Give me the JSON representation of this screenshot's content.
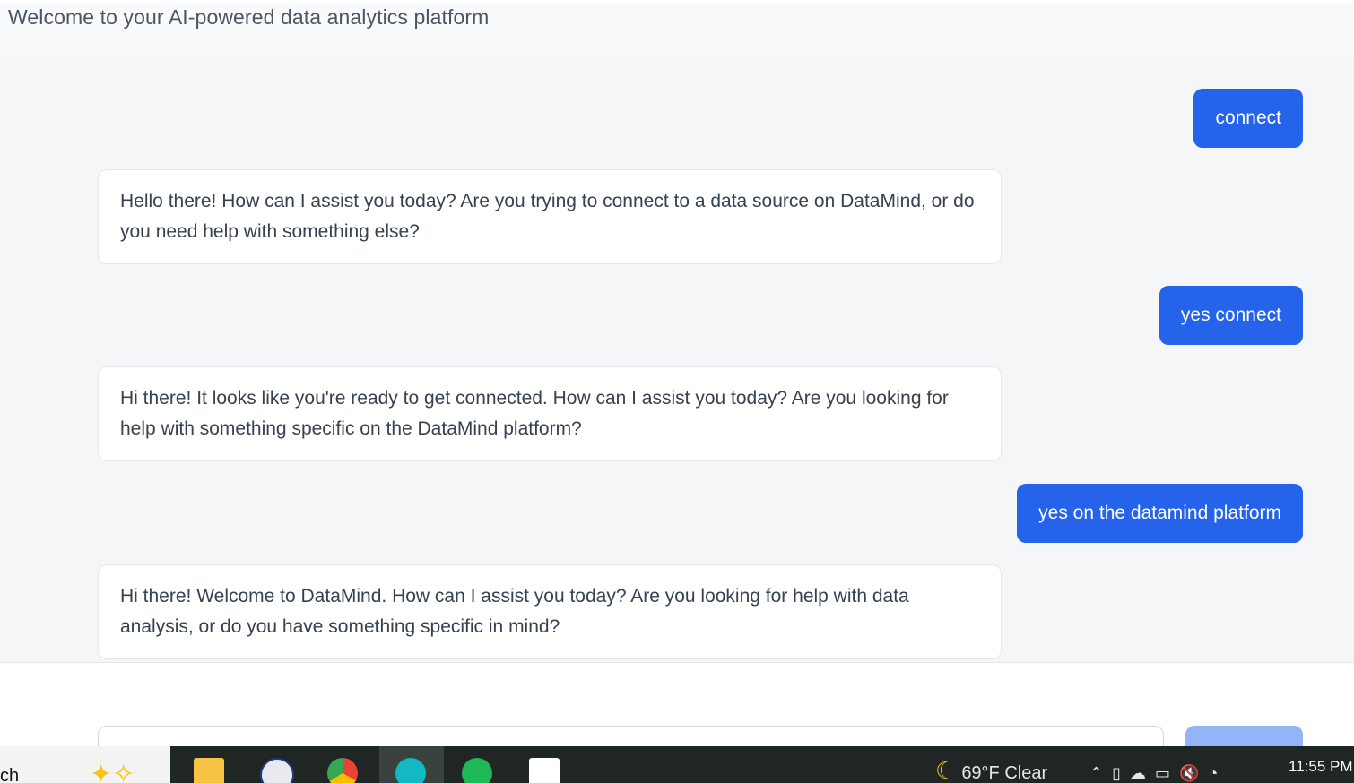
{
  "header": {
    "subtitle": "Welcome to your AI-powered data analytics platform"
  },
  "messages": [
    {
      "role": "user",
      "text": "connect"
    },
    {
      "role": "assistant",
      "text": "Hello there! How can I assist you today? Are you trying to connect to a data source on DataMind, or do you need help with something else?"
    },
    {
      "role": "user",
      "text": "yes connect"
    },
    {
      "role": "assistant",
      "text": "Hi there! It looks like you're ready to get connected. How can I assist you today? Are you looking for help with something specific on the DataMind platform?"
    },
    {
      "role": "user",
      "text": "yes on the datamind platform"
    },
    {
      "role": "assistant",
      "text": "Hi there! Welcome to DataMind. How can I assist you today? Are you looking for help with data analysis, or do you have something specific in mind?"
    }
  ],
  "taskbar": {
    "search_text": "ch",
    "weather_temp": "69°F",
    "weather_cond": "Clear",
    "clock": "11:55 PM",
    "icons": [
      "file-explorer-icon",
      "dhs-seal-icon",
      "chrome-icon",
      "app-swirl-icon",
      "spotify-icon",
      "wix-icon"
    ]
  },
  "colors": {
    "accent": "#2563eb",
    "send_disabled": "#93b4f6"
  }
}
